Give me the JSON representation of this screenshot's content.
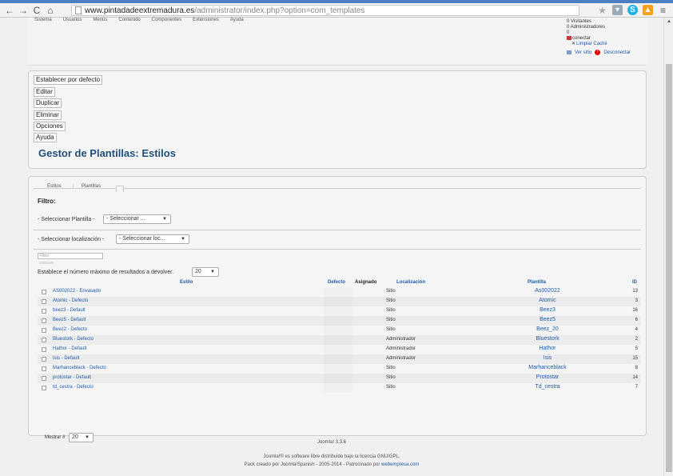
{
  "browser": {
    "url_host": "www.pintadadeextremadura.es",
    "url_path": "/administrator/index.php?option=com_templates"
  },
  "header": {
    "menu": [
      "Sistema",
      "Usuarios",
      "Menús",
      "Contenido",
      "Componentes",
      "Extensiones",
      "Ayuda"
    ],
    "status": {
      "visitors": "0 Visitantes",
      "admins": "0 Administradores",
      "count": "0",
      "disconnect_small": "conectar",
      "clear_cache": "Limpiar Caché",
      "view_site": "Ver sitio",
      "logout": "Desconectar"
    }
  },
  "toolbar": {
    "buttons": [
      "Establecer por defecto",
      "Editar",
      "Duplicar",
      "Eliminar",
      "Opciones",
      "Ayuda"
    ],
    "title": "Gestor de Plantillas: Estilos"
  },
  "tabs": [
    "Estilos",
    "Plantillas"
  ],
  "filter": {
    "title": "Filtro:",
    "template_label": "- Seleccionar Plantilla -",
    "template_value": "- Seleccionar ...",
    "location_label": "- Seleccionar localización -",
    "location_value": "- Seleccionar loc...",
    "search_placeholder": "Filtro",
    "limit_label": "Establece el número máximo de resultados a devolver.",
    "limit_value": "20"
  },
  "table": {
    "headers": {
      "style": "Estilo",
      "default": "Defecto",
      "assigned": "Asignado",
      "location": "Localización",
      "template": "Plantilla",
      "id": "ID"
    },
    "rows": [
      {
        "name": "AS002022 - Envasado",
        "location": "Sitio",
        "template": "As002022",
        "id": "13"
      },
      {
        "name": "Atomic - Defecto",
        "location": "Sitio",
        "template": "Atomic",
        "id": "3"
      },
      {
        "name": "beez3 - Default",
        "location": "Sitio",
        "template": "Beez3",
        "id": "16"
      },
      {
        "name": "Beez5 - Default",
        "location": "Sitio",
        "template": "Beez5",
        "id": "6"
      },
      {
        "name": "Beez2 - Defecto",
        "location": "Sitio",
        "template": "Beez_20",
        "id": "4"
      },
      {
        "name": "Bluestork - Defecto",
        "location": "Administrador",
        "template": "Bluestork",
        "id": "2"
      },
      {
        "name": "Hathor - Default",
        "location": "Administrador",
        "template": "Hathor",
        "id": "5"
      },
      {
        "name": "Isis - Default",
        "location": "Administrador",
        "template": "Isis",
        "id": "15"
      },
      {
        "name": "Marhanceblack - Defecto",
        "location": "Sitio",
        "template": "Marhanceblack",
        "id": "8"
      },
      {
        "name": "protostar - Default",
        "location": "Sitio",
        "template": "Protostar",
        "id": "14"
      },
      {
        "name": "td_cestra - Defecto",
        "location": "Sitio",
        "template": "Td_cestra",
        "id": "7"
      }
    ],
    "show_label": "Mostrar #",
    "show_value": "20"
  },
  "footer": {
    "version": "Joomla! 3.3.6",
    "license": "Joomla!® es software libre distribuido bajo la licencia GNU/GPL.",
    "pack": "Pack creado por Joomla!Spanish - 2005-2014 - Patrocinado por",
    "sponsor": "webempresa.com"
  }
}
